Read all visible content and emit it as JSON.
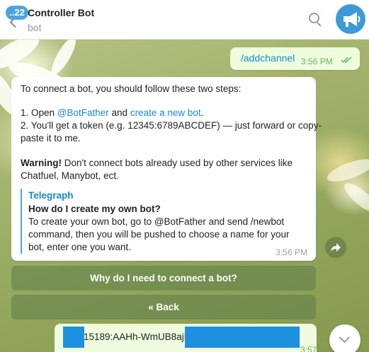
{
  "header": {
    "unread_count": "22",
    "title": "Controller Bot",
    "subtitle": "bot"
  },
  "messages": {
    "command": {
      "text": "/addchannel",
      "time": "3:56 PM",
      "status": "read"
    },
    "bot_reply": {
      "line1": "To connect a bot, you should follow these two steps:",
      "step1_prefix": "1. Open ",
      "step1_link1": "@BotFather",
      "step1_mid": " and ",
      "step1_link2": "create a new bot",
      "step1_suffix": ".",
      "step2_line1": "2. You'll get a token (e.g. 12345:6789ABCDEF) — just forward or copy-",
      "step2_line2": "paste it to me.",
      "warning_label": "Warning!",
      "warning_line1": " Don't connect bots already used by other services like",
      "warning_line2": "Chatfuel, Manybot, ect.",
      "preview_site": "Telegraph",
      "preview_title": "How do I create my own bot?",
      "preview_line1": "To create your own bot, go to @BotFather and send /newbot",
      "preview_line2": "command, then you will be pushed to choose a name for your",
      "preview_line3": "bot, enter one you want.",
      "time": "3:56 PM"
    },
    "token": {
      "text": "15189:AAHh-WmUB8ajFi",
      "time": "3:57 PM"
    }
  },
  "keyboard": {
    "buttons": [
      "Why do I need to connect a bot?",
      "« Back"
    ]
  },
  "icons": {
    "back": "back-arrow-icon",
    "search": "search-icon",
    "avatar": "megaphone-icon",
    "share": "share-icon",
    "scroll": "chevron-down-icon"
  },
  "colors": {
    "accent": "#168acd",
    "badge": "#4ea4e0",
    "outgoing_bubble": "#effdde",
    "read_ticks": "#6cb36a",
    "redaction": "#1e90e0"
  }
}
